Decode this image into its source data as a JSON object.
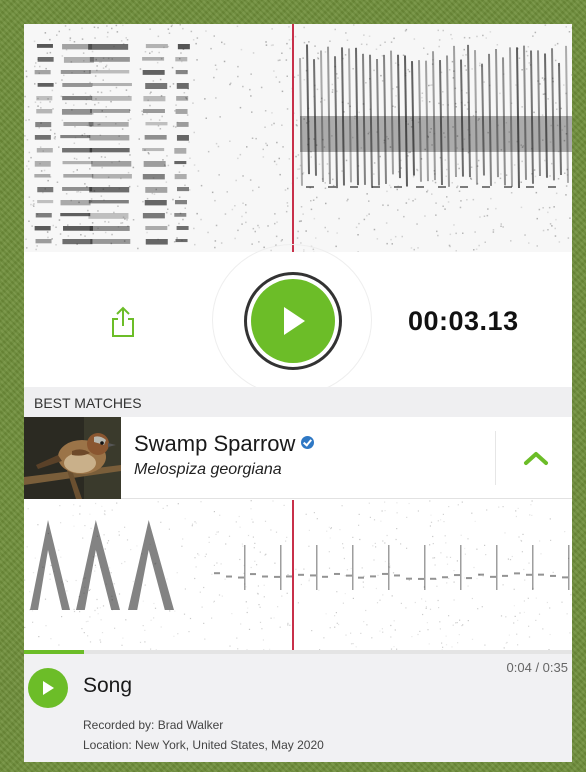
{
  "controls": {
    "elapsed_time": "00:03.13"
  },
  "section": {
    "header": "BEST MATCHES"
  },
  "match": {
    "common_name": "Swamp Sparrow",
    "scientific_name": "Melospiza georgiana"
  },
  "recording": {
    "type": "Song",
    "time": "0:04 / 0:35",
    "progress": 0.11,
    "recorded_by": "Recorded by: Brad Walker",
    "location": "Location: New York, United States, May 2020"
  },
  "colors": {
    "accent": "#6cbd28",
    "playhead": "#c8304a",
    "background_frame": "#6f8f3a",
    "verified": "#2f78c4"
  },
  "icons": {
    "share": "share-icon",
    "play": "play-icon",
    "collapse": "chevron-up-icon",
    "verified": "verified-icon"
  }
}
